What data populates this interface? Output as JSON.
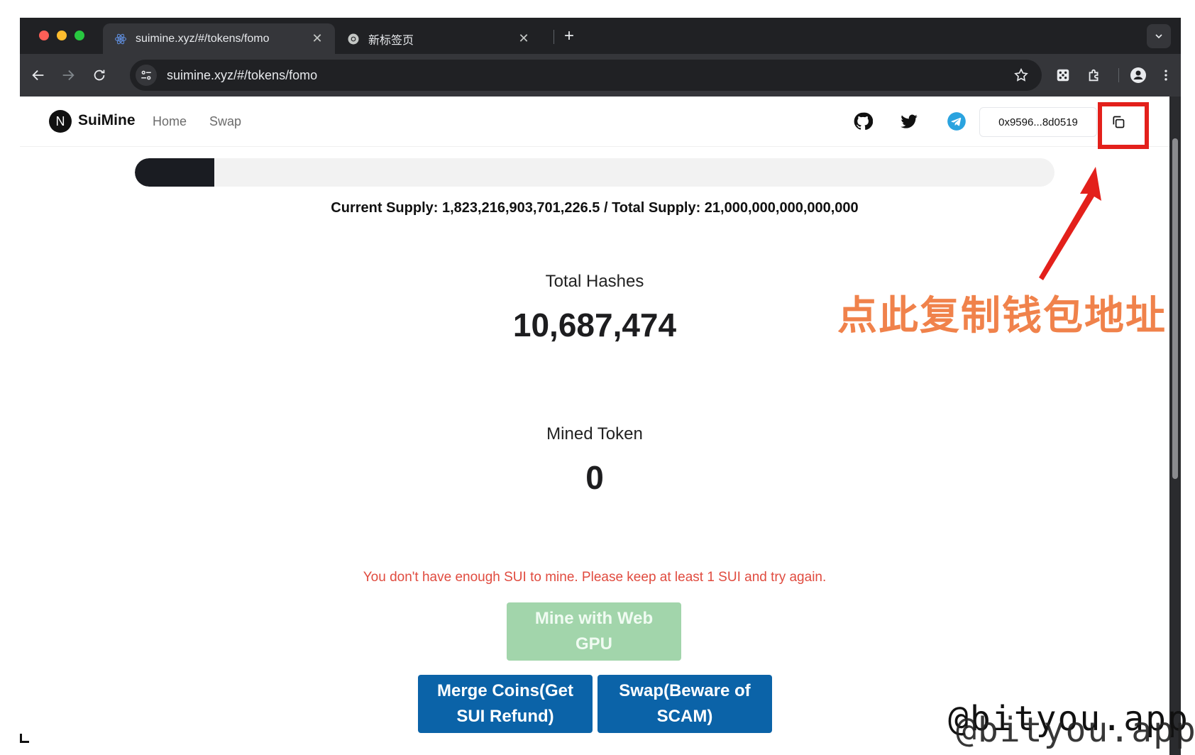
{
  "browser": {
    "tabs": [
      {
        "title": "suimine.xyz/#/tokens/fomo",
        "active": true,
        "favicon": "react-icon"
      },
      {
        "title": "新标签页",
        "active": false,
        "favicon": "chrome-icon"
      }
    ],
    "close_glyph": "✕",
    "new_tab_glyph": "+",
    "url": "suimine.xyz/#/tokens/fomo"
  },
  "navbar": {
    "logo_letter": "N",
    "brand": "SuiMine",
    "links": [
      "Home",
      "Swap"
    ],
    "wallet_address": "0x9596...8d0519"
  },
  "supply": {
    "text": "Current Supply: 1,823,216,903,701,226.5 / Total Supply: 21,000,000,000,000,000",
    "progress_fraction": 0.0868
  },
  "stats": {
    "total_hashes_label": "Total Hashes",
    "total_hashes_value": "10,687,474",
    "mined_token_label": "Mined Token",
    "mined_token_value": "0"
  },
  "warning": "You don't have enough SUI to mine. Please keep at least 1 SUI and try again.",
  "buttons": {
    "mine": "Mine with Web GPU",
    "merge": "Merge Coins(Get SUI Refund)",
    "swap": "Swap(Beware of SCAM)"
  },
  "annotation": "点此复制钱包地址",
  "watermark": "@bityou.app",
  "colors": {
    "annotation_red": "#e3201b",
    "annotation_orange": "#f0824b",
    "button_blue": "#0b63a8",
    "button_green_disabled": "#a2d5ab",
    "warning_red": "#e04b3f"
  }
}
